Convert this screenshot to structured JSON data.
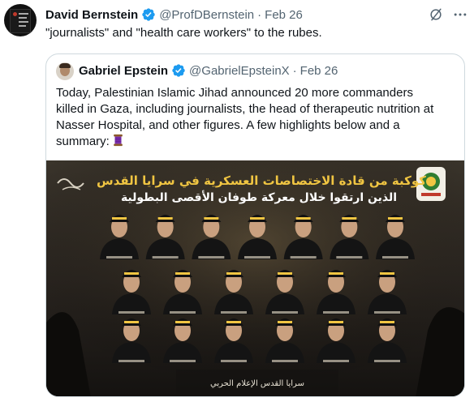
{
  "tweet": {
    "author_name": "David Bernstein",
    "handle": "@ProfDBernstein",
    "separator": "·",
    "date": "Feb 26",
    "text": "\"journalists\" and \"health care workers\" to the rubes.",
    "icons": {
      "verified": "verified-badge-icon",
      "top": "slashed-circle-icon",
      "more": "more-icon"
    }
  },
  "quoted_tweet": {
    "author_name": "Gabriel Epstein",
    "handle": "@GabrielEpsteinX",
    "separator": "·",
    "date": "Feb 26",
    "text_lines": [
      "Today, Palestinian Islamic Jihad announced 20 more commanders",
      "killed in Gaza, including journalists, the head of therapeutic nutrition at",
      "Nasser Hospital, and other figures. A few highlights below and a",
      "summary:"
    ],
    "emoji": "spool-of-thread-icon"
  },
  "media": {
    "title_line_1": "كوكبة من قادة الاختصاصات العسكرية في سرايا القدس",
    "title_line_2": "الذين ارتقوا خلال معركة طوفان الأقصى البطولية",
    "footer": "سرايا القدس الإعلام الحربي",
    "portrait_rows": [
      7,
      6,
      6
    ],
    "colors": {
      "background": "#1b1916",
      "title": "#f0c542",
      "uniform": "#141414",
      "skin": "#c9a07f"
    }
  },
  "colors": {
    "text": "#0f1419",
    "secondary": "#536471",
    "verified": "#1d9bf0",
    "border": "#cfd9de"
  }
}
